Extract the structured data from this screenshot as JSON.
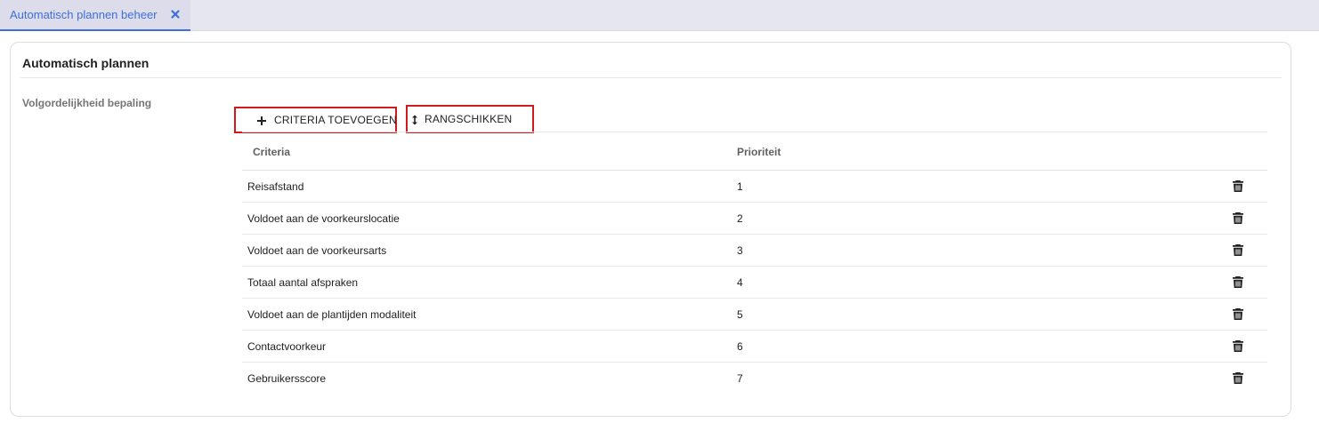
{
  "tabs": [
    {
      "label": "Automatisch plannen beheer",
      "active": true
    }
  ],
  "card": {
    "title": "Automatisch plannen",
    "section_label": "Volgordelijkheid bepaling"
  },
  "toolbar": {
    "add_label": "CRITERIA TOEVOEGEN",
    "rank_label": "RANGSCHIKKEN"
  },
  "table": {
    "columns": [
      "Criteria",
      "Prioriteit"
    ],
    "rows": [
      {
        "criteria": "Reisafstand",
        "priority": "1"
      },
      {
        "criteria": "Voldoet aan de voorkeurslocatie",
        "priority": "2"
      },
      {
        "criteria": "Voldoet aan de voorkeursarts",
        "priority": "3"
      },
      {
        "criteria": "Totaal aantal afspraken",
        "priority": "4"
      },
      {
        "criteria": "Voldoet aan de plantijden modaliteit",
        "priority": "5"
      },
      {
        "criteria": "Contactvoorkeur",
        "priority": "6"
      },
      {
        "criteria": "Gebruikersscore",
        "priority": "7"
      }
    ]
  },
  "icons": {
    "tab_close": "close-icon",
    "add": "plus-icon",
    "rank": "swap-vertical-icon",
    "delete": "trash-icon"
  },
  "colors": {
    "accent": "#3f6fd8",
    "highlight": "#d11a1a",
    "tabbar": "#e6e6ef"
  }
}
